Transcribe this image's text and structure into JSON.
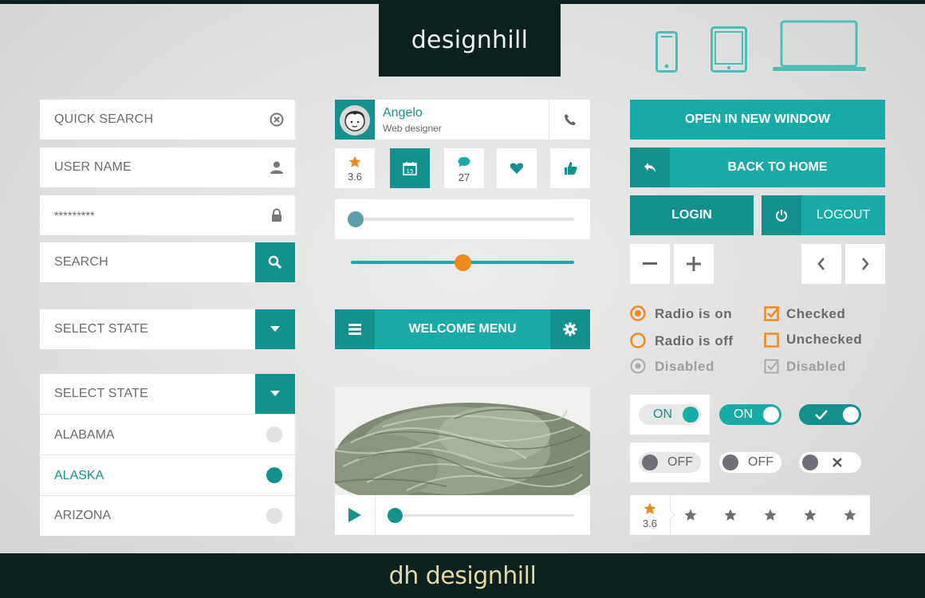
{
  "brand": {
    "logo_text": "designhill",
    "footer_text": "dh designhill"
  },
  "colors": {
    "teal": "#17aaa6",
    "dark_teal": "#14918e",
    "orange": "#f08a1c",
    "dark": "#0b201f"
  },
  "devices": [
    "phone-icon",
    "tablet-icon",
    "laptop-icon"
  ],
  "inputs": {
    "quick_search": "QUICK SEARCH",
    "user_name": "USER NAME",
    "password": "*********",
    "search": "SEARCH"
  },
  "select1": {
    "label": "SELECT STATE"
  },
  "select2": {
    "label": "SELECT STATE",
    "options": [
      "ALABAMA",
      "ALASKA",
      "ARIZONA"
    ],
    "selected": "ALASKA"
  },
  "profile": {
    "name": "Angelo",
    "role": "Web designer"
  },
  "stats": {
    "rating": "3.6",
    "calendar_day": "15",
    "comments": "27"
  },
  "sliders": {
    "slider1_value": 0.0,
    "slider2_value": 0.5
  },
  "welcome_menu": {
    "label": "WELCOME MENU"
  },
  "buttons": {
    "open_new_window": "OPEN IN NEW WINDOW",
    "back_to_home": "BACK TO HOME",
    "login": "LOGIN",
    "logout": "LOGOUT"
  },
  "radios": [
    {
      "label": "Radio is on",
      "state": "on"
    },
    {
      "label": "Radio is off",
      "state": "off"
    },
    {
      "label": "Disabled",
      "state": "disabled"
    }
  ],
  "checkboxes": [
    {
      "label": "Checked",
      "state": "checked"
    },
    {
      "label": "Unchecked",
      "state": "unchecked"
    },
    {
      "label": "Disabled",
      "state": "disabled"
    }
  ],
  "toggles": {
    "on": "ON",
    "off": "OFF"
  },
  "video": {
    "progress": 0.0
  },
  "rating_bar": {
    "rating": "3.6",
    "stars": 5
  }
}
